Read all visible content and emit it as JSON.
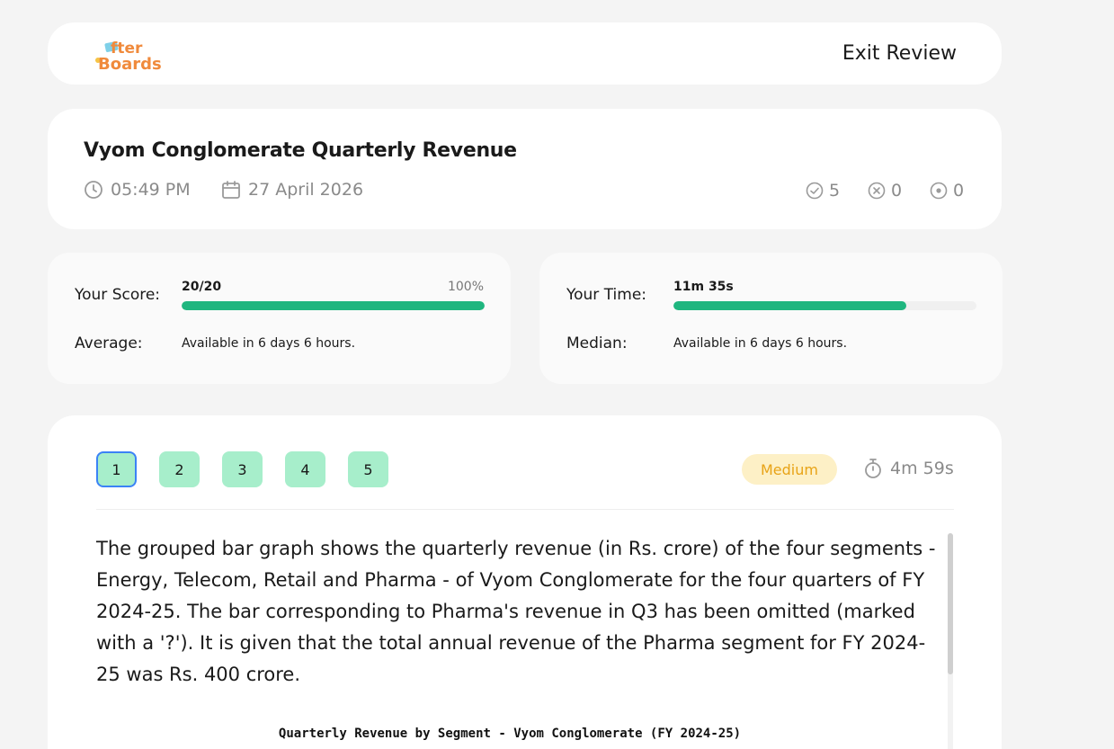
{
  "header": {
    "logo_text_top": "fter",
    "logo_text_bottom": "Boards",
    "exit_label": "Exit Review"
  },
  "test": {
    "title": "Vyom Conglomerate Quarterly Revenue",
    "time": "05:49 PM",
    "date": "27 April 2026",
    "correct_count": "5",
    "wrong_count": "0",
    "skipped_count": "0"
  },
  "score": {
    "label": "Your Score:",
    "value": "20/20",
    "percent": "100%",
    "fill_fraction": 1.0,
    "average_label": "Average:",
    "average_value": "Available in 6 days 6 hours."
  },
  "time_stats": {
    "label": "Your Time:",
    "value": "11m 35s",
    "fill_fraction": 0.77,
    "median_label": "Median:",
    "median_value": "Available in 6 days 6 hours."
  },
  "question": {
    "nav": [
      "1",
      "2",
      "3",
      "4",
      "5"
    ],
    "active_index": 0,
    "difficulty": "Medium",
    "time_taken": "4m 59s",
    "text": "The grouped bar graph shows the quarterly revenue (in Rs. crore) of the four segments - Energy, Telecom, Retail and Pharma - of Vyom Conglomerate for the four quarters of FY 2024-25. The bar corresponding to Pharma's revenue in Q3 has been omitted (marked with a '?'). It is given that the total annual revenue of the Pharma segment for FY 2024-25 was Rs. 400 crore.",
    "chart_title": "Quarterly Revenue by Segment - Vyom Conglomerate (FY 2024-25)"
  },
  "colors": {
    "accent_green": "#1fb67f",
    "nav_button": "#a7eecb",
    "active_border": "#3b82f6",
    "badge_bg": "#fdf0c6",
    "badge_text": "#e8a317",
    "logo_orange": "#f08a3c"
  }
}
